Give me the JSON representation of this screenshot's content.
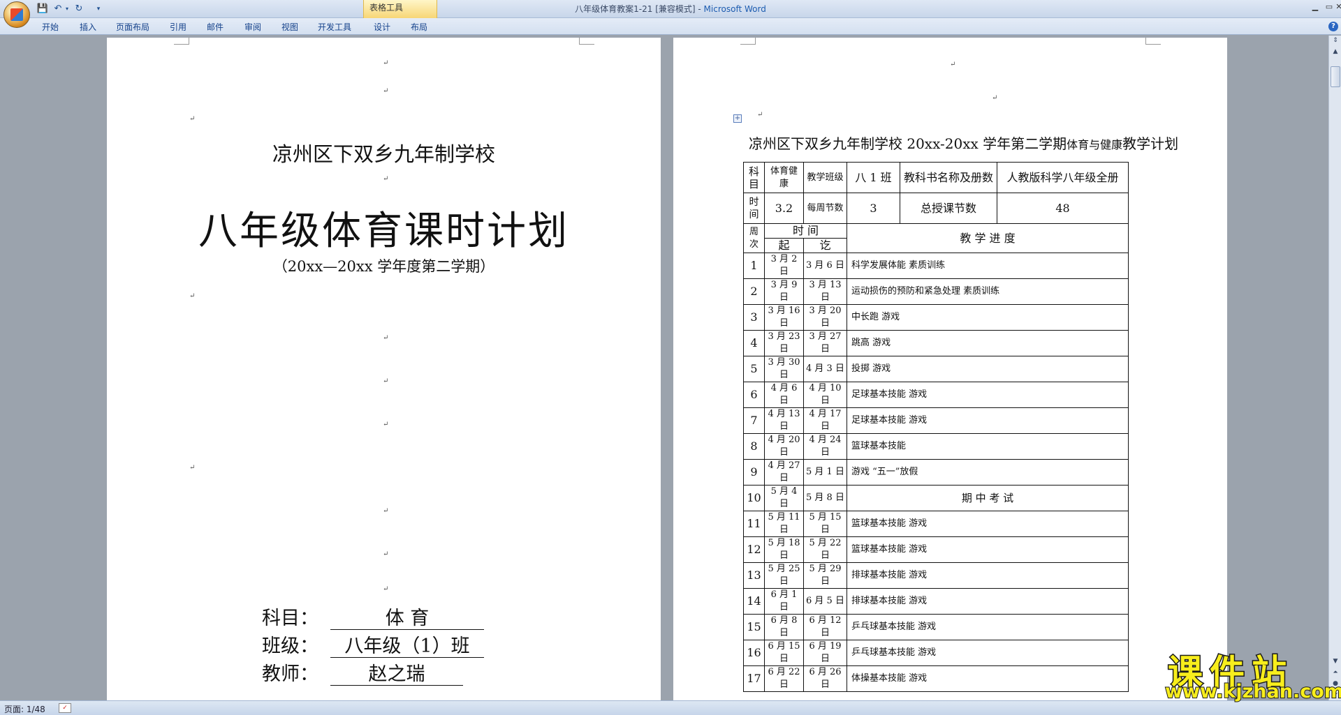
{
  "window": {
    "doc_name": "八年级体育教案1-21 [兼容模式]",
    "separator": " - ",
    "app_name": "Microsoft Word",
    "tool_tab_group": "表格工具",
    "controls": {
      "minimize": "▁",
      "maximize": "▭",
      "close": "✕"
    }
  },
  "quick_access": {
    "save_icon": "💾",
    "undo_icon": "↶",
    "undo_drop": "▾",
    "redo_icon": "↻",
    "more": "▾"
  },
  "ribbon": {
    "tabs": [
      "开始",
      "插入",
      "页面布局",
      "引用",
      "邮件",
      "审阅",
      "视图",
      "开发工具",
      "设计",
      "布局"
    ],
    "help": "?"
  },
  "paragraph_mark": "↵",
  "cover": {
    "school": "凉州区下双乡九年制学校",
    "title": "八年级体育课时计划",
    "term": "（20xx—20xx 学年度第二学期）",
    "subject_label": "科目：",
    "subject_value": "体      育",
    "class_label": "班级：",
    "class_value": "八年级（1）班",
    "teacher_label": "教师：",
    "teacher_value": "赵之瑞"
  },
  "plan": {
    "heading_main": "凉州区下双乡九年制学校 20xx-20xx 学年第二学期",
    "heading_small": "体育与健康",
    "heading_end": "教学计划",
    "table_handle": "+",
    "header": {
      "subject_label": "科目",
      "subject_value": "体育健康",
      "class_label": "教学班级",
      "class_value": "八 1 班",
      "book_label": "教科书名称及册数",
      "book_value": "人教版科学八年级全册",
      "time_label": "时间",
      "time_value": "3.2",
      "weekly_label": "每周节数",
      "weekly_value": "3",
      "total_label": "总授课节数",
      "total_value": "48",
      "week_col": "周次",
      "time_col": "时      间",
      "start_col": "起",
      "end_col": "讫",
      "progress_col": "教    学    进    度"
    },
    "rows": [
      {
        "week": "1",
        "start": "3 月 2 日",
        "end": "3 月 6 日",
        "content": "科学发展体能  素质训练"
      },
      {
        "week": "2",
        "start": "3 月 9 日",
        "end": "3 月 13 日",
        "content": "运动损伤的预防和紧急处理  素质训练"
      },
      {
        "week": "3",
        "start": "3 月 16 日",
        "end": "3 月 20 日",
        "content": "中长跑    游戏"
      },
      {
        "week": "4",
        "start": "3 月 23 日",
        "end": "3 月 27 日",
        "content": "跳高    游戏"
      },
      {
        "week": "5",
        "start": "3 月 30 日",
        "end": "4 月 3 日",
        "content": "投掷    游戏"
      },
      {
        "week": "6",
        "start": "4 月 6 日",
        "end": "4 月 10 日",
        "content": "足球基本技能    游戏"
      },
      {
        "week": "7",
        "start": "4 月 13 日",
        "end": "4 月 17 日",
        "content": "足球基本技能    游戏"
      },
      {
        "week": "8",
        "start": "4 月 20 日",
        "end": "4 月 24 日",
        "content": "篮球基本技能"
      },
      {
        "week": "9",
        "start": "4 月 27 日",
        "end": "5 月 1 日",
        "content": "游戏          “五一”放假"
      },
      {
        "week": "10",
        "start": "5 月 4 日",
        "end": "5 月 8 日",
        "content": "期      中      考      试"
      },
      {
        "week": "11",
        "start": "5 月 11 日",
        "end": "5 月 15 日",
        "content": "篮球基本技能    游戏"
      },
      {
        "week": "12",
        "start": "5 月 18 日",
        "end": "5 月 22 日",
        "content": "篮球基本技能    游戏"
      },
      {
        "week": "13",
        "start": "5 月 25 日",
        "end": "5 月 29 日",
        "content": "排球基本技能    游戏"
      },
      {
        "week": "14",
        "start": "6 月 1 日",
        "end": "6 月 5 日",
        "content": "排球基本技能    游戏"
      },
      {
        "week": "15",
        "start": "6 月 8 日",
        "end": "6 月 12 日",
        "content": "乒乓球基本技能    游戏"
      },
      {
        "week": "16",
        "start": "6 月 15 日",
        "end": "6 月 19 日",
        "content": "乒乓球基本技能    游戏"
      },
      {
        "week": "17",
        "start": "6 月 22 日",
        "end": "6 月 26 日",
        "content": "体操基本技能    游戏"
      }
    ]
  },
  "status": {
    "page": "页面: 1/48",
    "proof_icon": "✓"
  },
  "scrollbar": {
    "up": "▲",
    "down": "▼",
    "prev_page": "⏶",
    "browse": "●",
    "next_page": "⏷",
    "split": "⇕"
  },
  "watermark": {
    "cn": "课件站",
    "url": "www.kjzhan.com"
  }
}
